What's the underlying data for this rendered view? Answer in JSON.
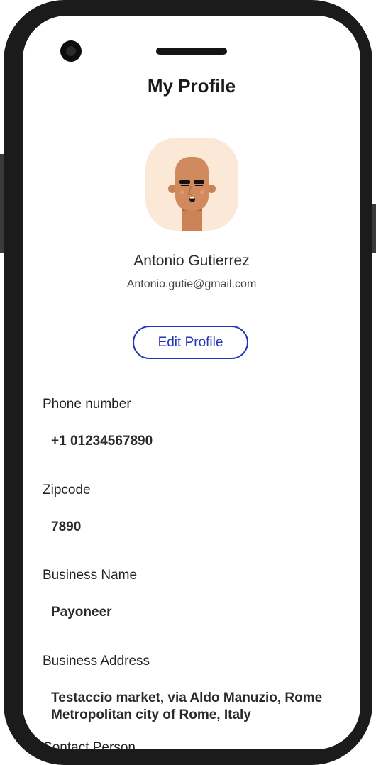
{
  "header": {
    "title": "My Profile"
  },
  "profile": {
    "name": "Antonio Gutierrez",
    "email": "Antonio.gutie@gmail.com",
    "edit_label": "Edit Profile"
  },
  "fields": [
    {
      "label": "Phone number",
      "value": "+1 01234567890"
    },
    {
      "label": "Zipcode",
      "value": "7890"
    },
    {
      "label": "Business Name",
      "value": "Payoneer"
    },
    {
      "label": "Business Address",
      "value_line1": "Testaccio market, via Aldo Manuzio, Rome",
      "value_line2": "Metropolitan city of Rome, Italy"
    },
    {
      "label": "Contact Person"
    }
  ],
  "colors": {
    "accent": "#2334b8",
    "phone_frame": "#1b1b1b",
    "avatar_bg": "#fbe8d6",
    "skin": "#d08a5e"
  },
  "icons": {
    "avatar": "person-avatar-illustration",
    "camera": "front-camera",
    "speaker": "earpiece-speaker"
  }
}
